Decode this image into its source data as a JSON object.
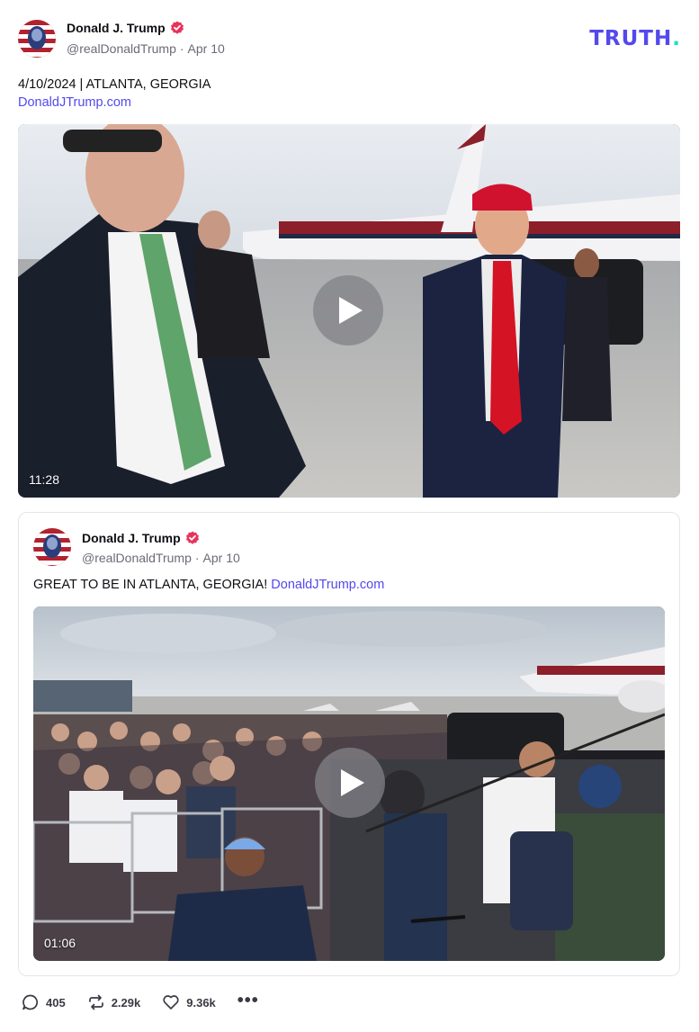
{
  "post": {
    "author_name": "Donald J. Trump",
    "handle": "@realDonaldTrump",
    "separator": "·",
    "date": "Apr 10",
    "text": "4/10/2024 | ATLANTA, GEORGIA",
    "link": "DonaldJTrump.com",
    "video": {
      "duration": "11:28"
    }
  },
  "brand": {
    "logo_text": "TRUTH",
    "logo_dot": "."
  },
  "quote": {
    "author_name": "Donald J. Trump",
    "handle": "@realDonaldTrump",
    "separator": "·",
    "date": "Apr 10",
    "text": "GREAT TO BE IN ATLANTA, GEORGIA!",
    "link": "DonaldJTrump.com",
    "video": {
      "duration": "01:06"
    }
  },
  "actions": {
    "replies": "405",
    "retruths": "2.29k",
    "likes": "9.36k",
    "more": "•••"
  },
  "icons": {
    "verified": "verified-badge-icon",
    "reply": "reply-bubble-icon",
    "retruth": "retruth-arrows-icon",
    "like": "heart-icon",
    "more": "more-dots-icon",
    "play": "play-icon"
  },
  "colors": {
    "brand": "#5448ee",
    "brand_accent": "#17e2c7",
    "verified": "#e8335a",
    "link": "#5448ee",
    "muted": "#6b6b78"
  }
}
